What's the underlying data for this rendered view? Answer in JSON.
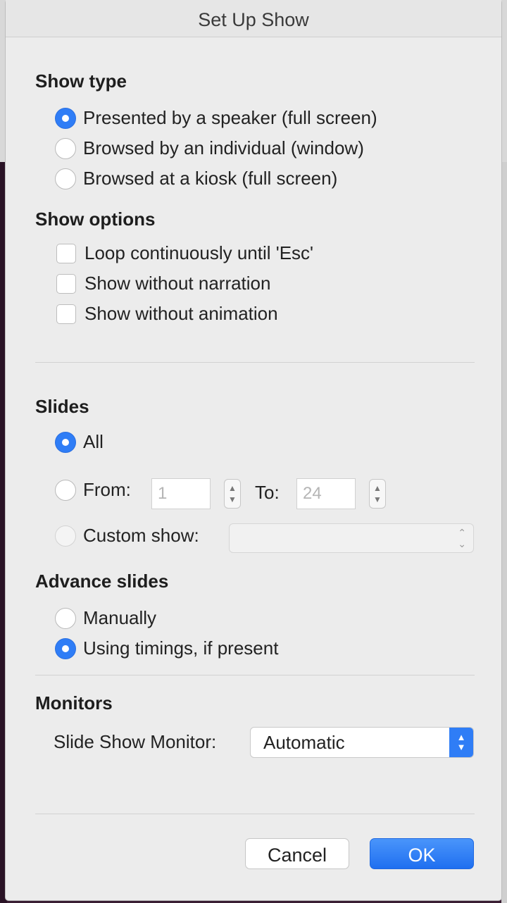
{
  "dialog": {
    "title": "Set Up Show"
  },
  "show_type": {
    "title": "Show type",
    "options": [
      {
        "label": "Presented by a speaker (full screen)",
        "checked": true
      },
      {
        "label": "Browsed by an individual (window)",
        "checked": false
      },
      {
        "label": "Browsed at a kiosk (full screen)",
        "checked": false
      }
    ]
  },
  "show_options": {
    "title": "Show options",
    "options": [
      {
        "label": "Loop continuously until 'Esc'",
        "checked": false
      },
      {
        "label": "Show without narration",
        "checked": false
      },
      {
        "label": "Show without animation",
        "checked": false
      }
    ]
  },
  "slides": {
    "title": "Slides",
    "all_label": "All",
    "from_label": "From:",
    "from_value": "1",
    "to_label": "To:",
    "to_value": "24",
    "custom_label": "Custom show:",
    "custom_value": ""
  },
  "advance": {
    "title": "Advance slides",
    "options": [
      {
        "label": "Manually",
        "checked": false
      },
      {
        "label": "Using timings, if present",
        "checked": true
      }
    ]
  },
  "monitors": {
    "title": "Monitors",
    "monitor_label": "Slide Show Monitor:",
    "monitor_value": "Automatic"
  },
  "buttons": {
    "cancel": "Cancel",
    "ok": "OK"
  },
  "colors": {
    "accent": "#2f7df6",
    "dialog_bg": "#ececec"
  }
}
